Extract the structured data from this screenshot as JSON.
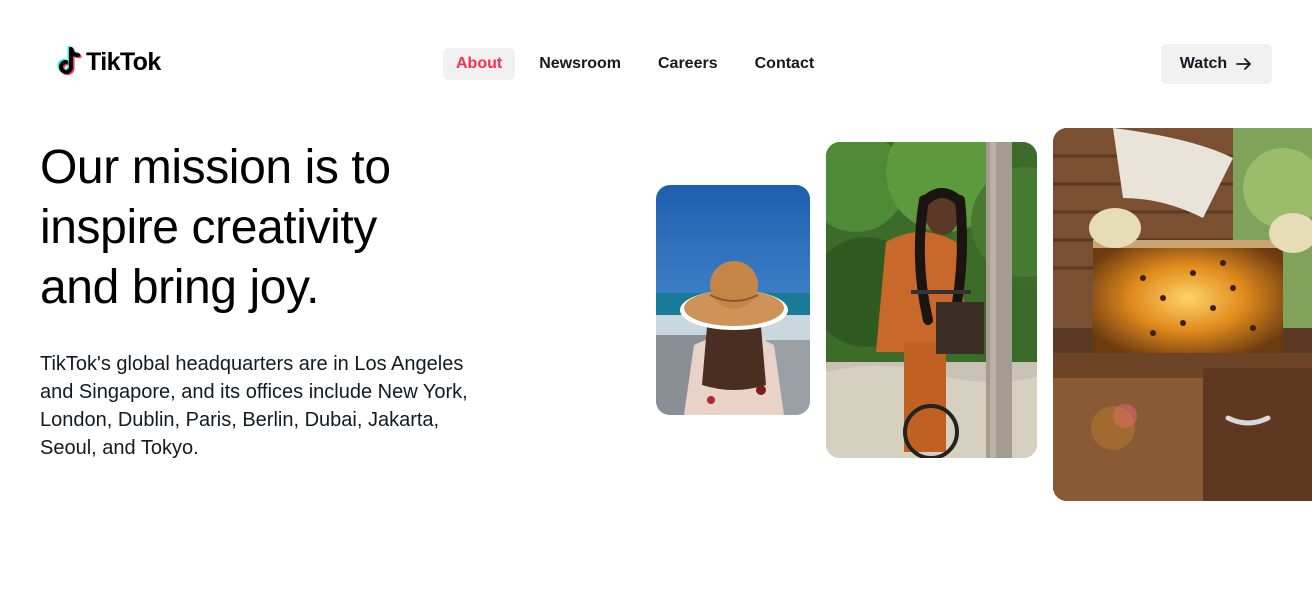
{
  "brand": {
    "name": "TikTok",
    "colors": {
      "cyan": "#25f4ee",
      "pink": "#fe2c55",
      "text": "#161823"
    }
  },
  "nav": {
    "items": [
      {
        "label": "About",
        "active": true
      },
      {
        "label": "Newsroom",
        "active": false
      },
      {
        "label": "Careers",
        "active": false
      },
      {
        "label": "Contact",
        "active": false
      }
    ]
  },
  "header": {
    "watch_label": "Watch",
    "watch_icon": "arrow-right-icon"
  },
  "hero": {
    "headline": "Our mission is to inspire creativity and bring joy.",
    "description": "TikTok's global headquarters are in Los Angeles and Singapore, and its offices include New York, London, Dublin, Paris, Berlin, Dubai, Jakarta, Seoul, and Tokyo."
  },
  "photos": [
    {
      "subject": "person-in-sun-hat-by-sea"
    },
    {
      "subject": "woman-riding-bicycle-in-park"
    },
    {
      "subject": "beekeeper-holding-honeycomb-frame"
    }
  ]
}
